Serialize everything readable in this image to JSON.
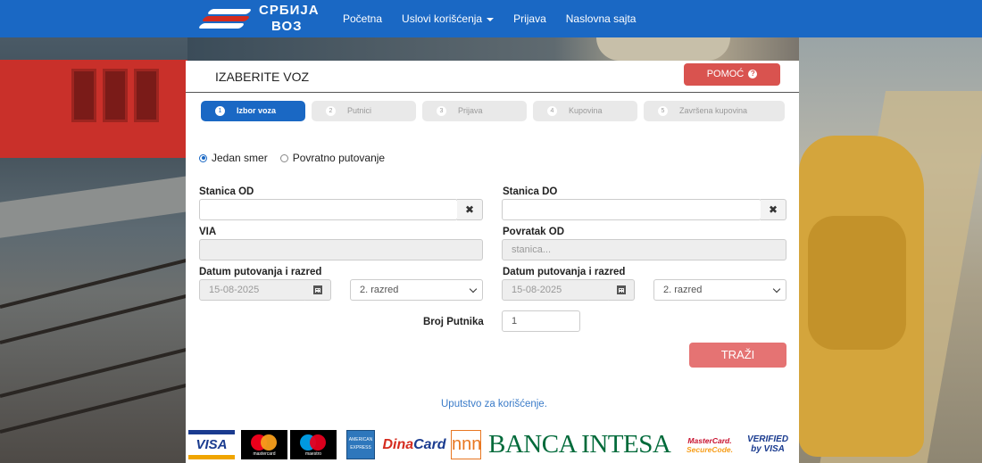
{
  "navbar": {
    "logo_line1": "СРБИЈА",
    "logo_line2": "ВОЗ",
    "links": [
      "Početna",
      "Uslovi korišćenja",
      "Prijava",
      "Naslovna sajta"
    ],
    "brand_color": "#1a68c4"
  },
  "panel": {
    "title": "IZABERITE VOZ",
    "help_label": "POMOĆ",
    "help_icon": "?"
  },
  "steps": [
    {
      "num": "1",
      "label": "Izbor voza",
      "active": true
    },
    {
      "num": "2",
      "label": "Putnici",
      "active": false
    },
    {
      "num": "3",
      "label": "Prijava",
      "active": false
    },
    {
      "num": "4",
      "label": "Kupovina",
      "active": false
    },
    {
      "num": "5",
      "label": "Završena kupovina",
      "active": false
    }
  ],
  "trip_type": {
    "one_way": "Jedan smer",
    "return": "Povratno putovanje",
    "selected": "one_way"
  },
  "form": {
    "from_label": "Stanica OD",
    "from_value": "",
    "to_label": "Stanica DO",
    "to_value": "",
    "via_label": "VIA",
    "via_value": "",
    "return_from_label": "Povratak OD",
    "return_from_placeholder": "stanica...",
    "date_label_1": "Datum putovanja i razred",
    "date_value_1": "15-08-2025",
    "class_value_1": "2. razred",
    "date_label_2": "Datum putovanja i razred",
    "date_value_2": "15-08-2025",
    "class_value_2": "2. razred",
    "passengers_label": "Broj Putnika",
    "passengers_value": "1",
    "clear_icon": "✖",
    "search_label": "TRAŽI"
  },
  "guide_link": "Uputstvo za korišćenje.",
  "payment_logos": {
    "visa": "VISA",
    "mastercard": "mastercard",
    "maestro": "maestro",
    "amex": "AMERICAN EXPRESS",
    "dina_a": "Dina",
    "dina_b": "Card",
    "nnn": "nnn",
    "intesa": "BANCA INTESA",
    "sc_a": "MasterCard.",
    "sc_b": "SecureCode.",
    "vbv_a": "VERIFIED",
    "vbv_b": "by VISA"
  }
}
